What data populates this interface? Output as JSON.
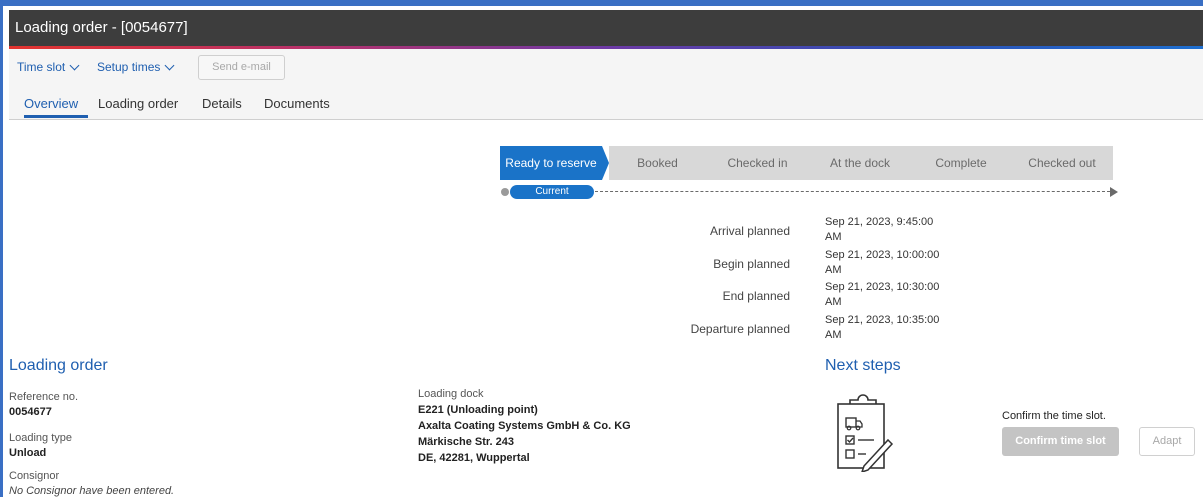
{
  "window": {
    "title": "Loading order - [0054677]"
  },
  "toolbar": {
    "time_slot": "Time slot",
    "setup_times": "Setup times",
    "send_email": "Send e-mail"
  },
  "tabs": [
    {
      "label": "Overview",
      "active": true
    },
    {
      "label": "Loading order",
      "active": false
    },
    {
      "label": "Details",
      "active": false
    },
    {
      "label": "Documents",
      "active": false
    }
  ],
  "status": {
    "steps": [
      "Ready to reserve",
      "Booked",
      "Checked in",
      "At the dock",
      "Complete",
      "Checked out"
    ],
    "current_label": "Current",
    "current_index": 0
  },
  "planned": [
    {
      "label": "Arrival planned",
      "value_line1": "Sep 21, 2023, 9:45:00",
      "value_line2": "AM"
    },
    {
      "label": "Begin planned",
      "value_line1": "Sep 21, 2023, 10:00:00",
      "value_line2": "AM"
    },
    {
      "label": "End planned",
      "value_line1": "Sep 21, 2023, 10:30:00",
      "value_line2": "AM"
    },
    {
      "label": "Departure planned",
      "value_line1": "Sep 21, 2023, 10:35:00",
      "value_line2": "AM"
    }
  ],
  "loading_order": {
    "title": "Loading order",
    "reference_label": "Reference no.",
    "reference_value": "0054677",
    "type_label": "Loading type",
    "type_value": "Unload",
    "consignor_label": "Consignor",
    "consignor_value": "No Consignor have been entered."
  },
  "dock": {
    "label": "Loading dock",
    "line1": "E221 (Unloading point)",
    "line2": "Axalta Coating Systems GmbH & Co. KG",
    "line3": "Märkische Str. 243",
    "line4": "DE, 42281, Wuppertal"
  },
  "next_steps": {
    "title": "Next steps",
    "hint": "Confirm the time slot.",
    "confirm_button": "Confirm time slot",
    "adapt_button": "Adapt",
    "illustration_icon": "clipboard-checklist-icon"
  },
  "colors": {
    "accent": "#1f5fb0",
    "active_step": "#1a73c8",
    "titlebar": "#3d3d3d",
    "frame": "#3a6fc4"
  }
}
